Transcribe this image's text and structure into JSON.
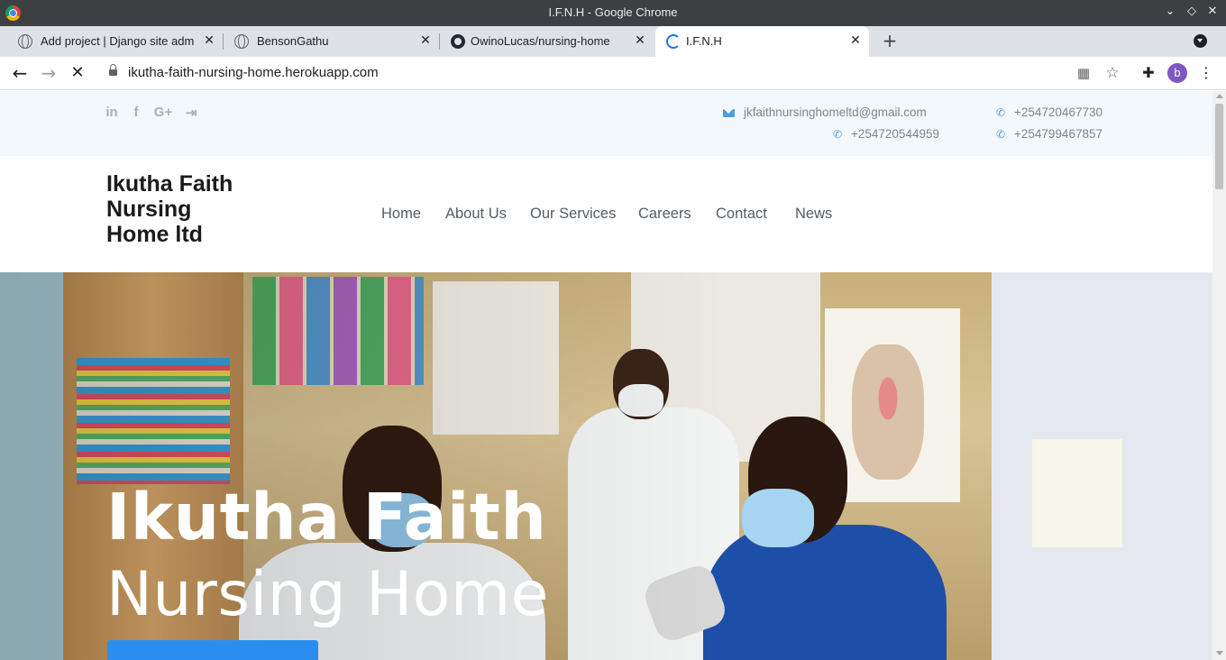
{
  "window": {
    "title": "I.F.N.H - Google Chrome"
  },
  "tabs": [
    {
      "label": "Add project | Django site adm",
      "favicon": "globe-icon"
    },
    {
      "label": "BensonGathu",
      "favicon": "globe-icon"
    },
    {
      "label": "OwinoLucas/nursing-home",
      "favicon": "github-icon"
    },
    {
      "label": "I.F.N.H",
      "favicon": "loading-spinner-icon",
      "active": true
    }
  ],
  "toolbar": {
    "url": "ikutha-faith-nursing-home.herokuapp.com",
    "profile_initial": "b"
  },
  "topbar": {
    "social": [
      {
        "icon": "linkedin-icon",
        "glyph": "in"
      },
      {
        "icon": "facebook-icon",
        "glyph": "f"
      },
      {
        "icon": "google-plus-icon",
        "glyph": "G+"
      },
      {
        "icon": "sign-in-icon",
        "glyph": "⇥"
      }
    ],
    "email": "jkfaithnursinghomeltd@gmail.com",
    "phone_1": "+254720467730",
    "phone_2": "+254720544959",
    "phone_3": "+254799467857"
  },
  "navbar": {
    "brand": "Ikutha Faith Nursing Home ltd",
    "links": [
      "Home",
      "About Us",
      "Our Services",
      "Careers",
      "Contact",
      "News"
    ]
  },
  "hero": {
    "title": "Ikutha Faith",
    "subtitle": "Nursing Home"
  },
  "colors": {
    "accent": "#2a8ef0",
    "topbar_bg": "#f3f8fc",
    "contact_icon": "#4a9fe4"
  }
}
